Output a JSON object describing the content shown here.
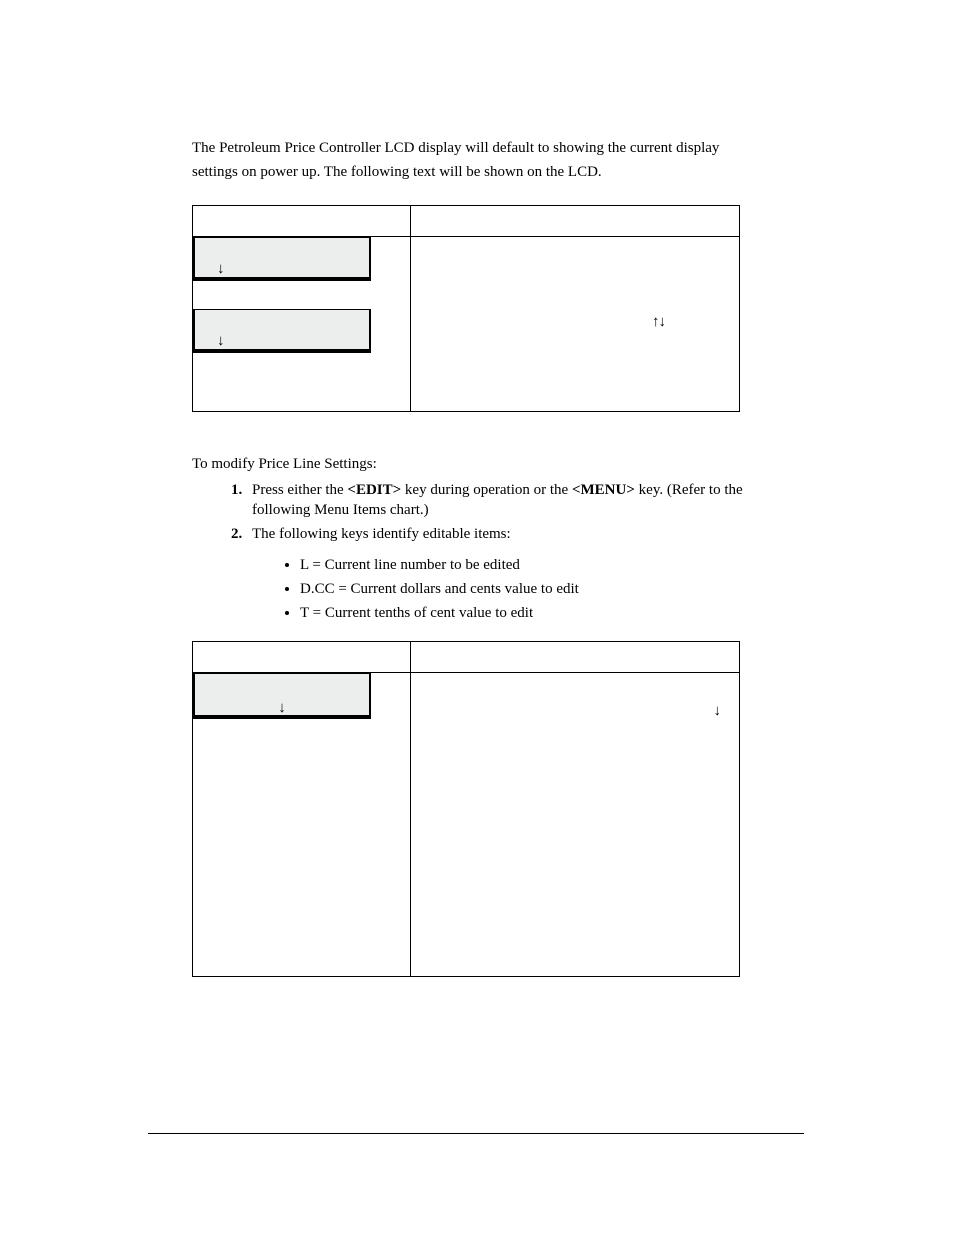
{
  "intro": {
    "line1": "The Petroleum Price Controller LCD display will default to showing the current display",
    "line2": "settings on power up. The following text will be shown on the LCD."
  },
  "table1": {
    "lcd1_arrow": "↓",
    "lcd2_arrow": "↓",
    "right_arrows": "↑↓"
  },
  "mid": {
    "lead": "To modify Price Line Settings:",
    "step1_a": "Press either the ",
    "step1_key1": "<EDIT>",
    "step1_b": " key during operation or the ",
    "step1_key2": "<MENU>",
    "step1_c": " key. (Refer to the",
    "step1_d": "following Menu Items chart.)",
    "step2": "The following keys identify editable items:",
    "sub1": "L = Current line number to be edited",
    "sub2": "D.CC = Current dollars and cents value to edit",
    "sub3": "T = Current tenths of cent value to edit"
  },
  "table2": {
    "lcd_arrow": "↓",
    "right_arrow": "↓"
  }
}
